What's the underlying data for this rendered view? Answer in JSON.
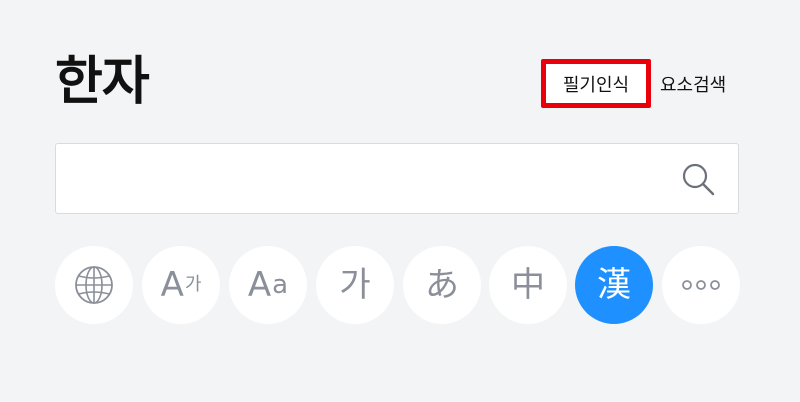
{
  "title": "한자",
  "buttons": {
    "handwriting": "필기인식",
    "element_search": "요소검색"
  },
  "search": {
    "value": "",
    "placeholder": ""
  },
  "languages": [
    {
      "name": "globe-icon",
      "label": "",
      "active": false
    },
    {
      "name": "A-ga",
      "label_main": "A",
      "label_sub": "가",
      "active": false
    },
    {
      "name": "A-a",
      "label_main": "A",
      "label_sub": "a",
      "active": false
    },
    {
      "name": "ga",
      "label": "가",
      "active": false
    },
    {
      "name": "a-hiragana",
      "label": "あ",
      "active": false
    },
    {
      "name": "zhong",
      "label": "中",
      "active": false
    },
    {
      "name": "han",
      "label": "漢",
      "active": true
    },
    {
      "name": "more-icon",
      "label": "",
      "active": false
    }
  ],
  "colors": {
    "background": "#f3f4f6",
    "highlight": "#e8000b",
    "active": "#1e90ff",
    "icon_gray": "#8a8f99"
  }
}
